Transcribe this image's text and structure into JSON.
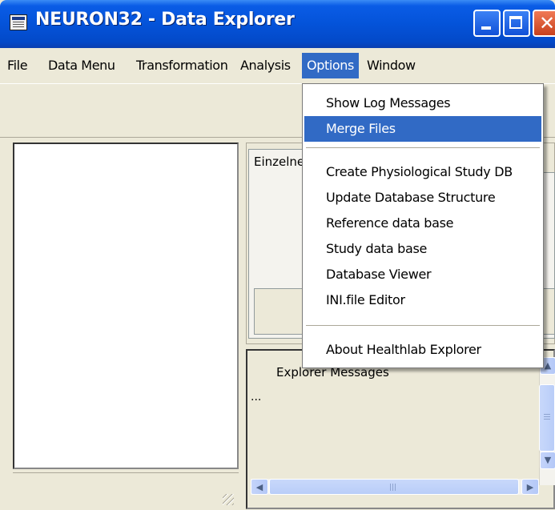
{
  "window": {
    "title": "NEURON32  -  Data Explorer",
    "icon": "app-window-icon",
    "controls": {
      "minimize": "minimize-icon",
      "maximize": "maximize-icon",
      "close": "close-icon"
    }
  },
  "menubar": {
    "items": [
      "File",
      "Data Menu",
      "Transformation",
      "Analysis",
      "Options",
      "Window"
    ],
    "active_index": 4
  },
  "options_menu": {
    "groups": [
      [
        "Show Log Messages",
        "Merge Files"
      ],
      [
        "Create Physiological Study DB",
        "Update Database Structure",
        "Reference data base",
        "Study data base",
        "Database Viewer",
        "INI.file Editor"
      ],
      [
        "About Healthlab Explorer"
      ]
    ],
    "highlighted": "Merge Files"
  },
  "right_panel": {
    "tab_label": "Einzelne"
  },
  "messages": {
    "title": "Explorer Messages",
    "content": "..."
  },
  "colors": {
    "titlebar": "#0453d9",
    "highlight": "#316ac5",
    "face": "#ece9d8"
  }
}
